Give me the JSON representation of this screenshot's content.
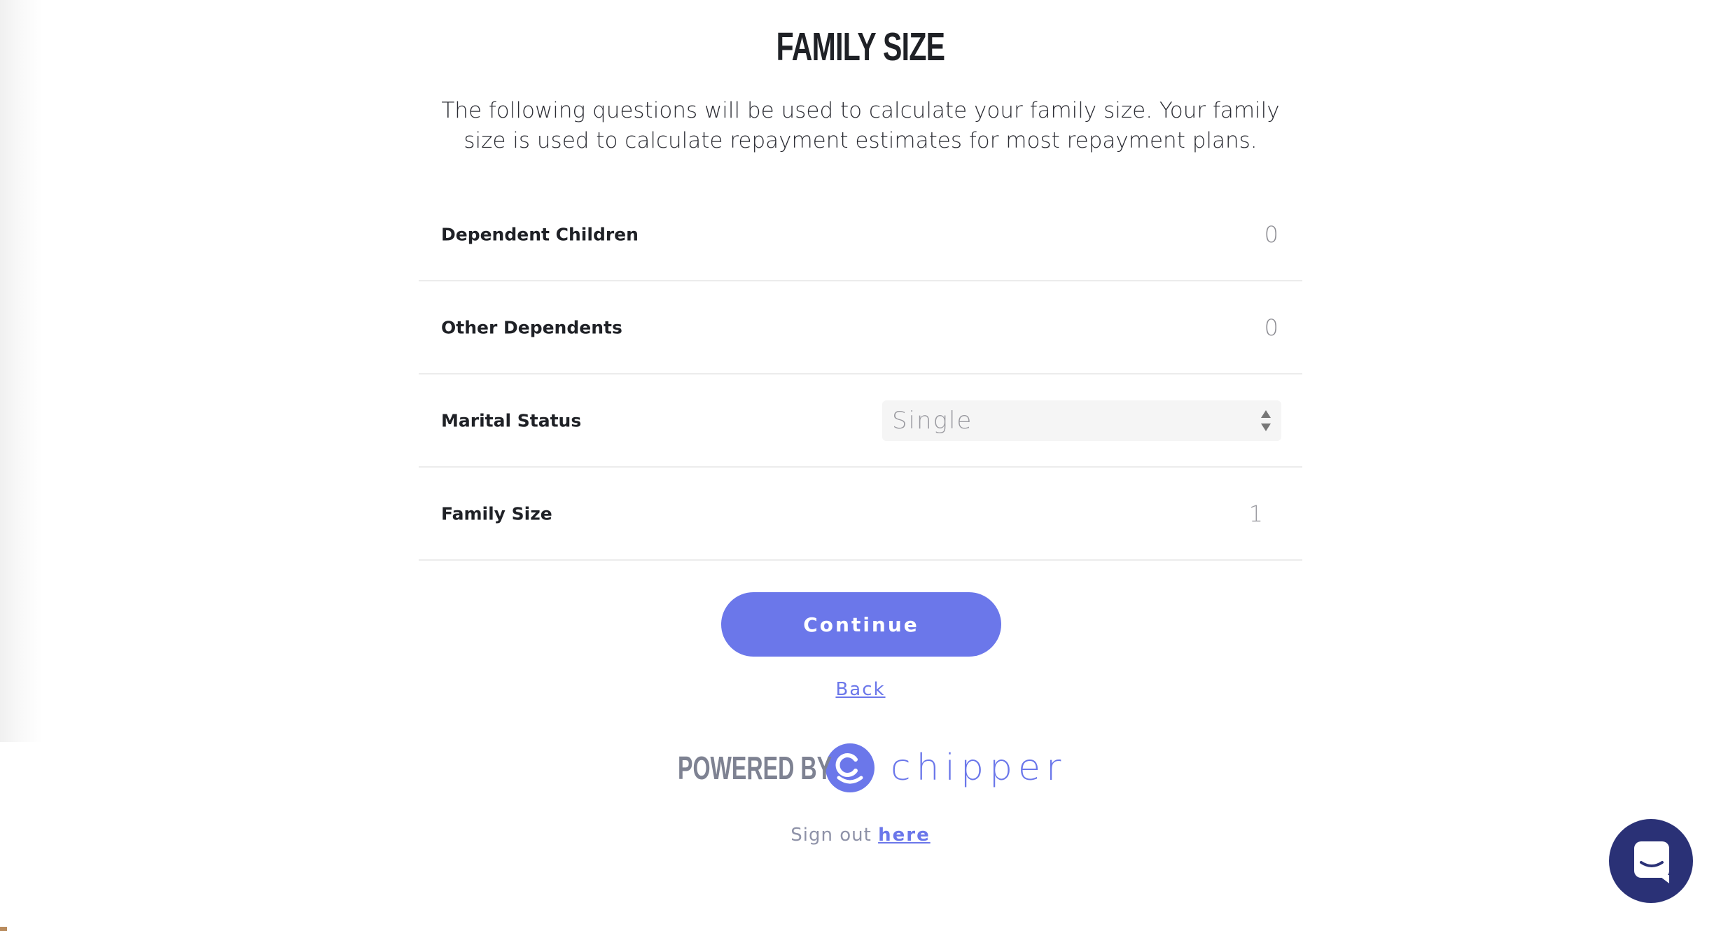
{
  "header": {
    "title": "FAMILY SIZE",
    "subtitle": "The following questions will be used to calculate your family size. Your family size is used to calculate repayment estimates for most repayment plans."
  },
  "form": {
    "dependent_children": {
      "label": "Dependent Children",
      "value": "0"
    },
    "other_dependents": {
      "label": "Other Dependents",
      "value": "0"
    },
    "marital_status": {
      "label": "Marital Status",
      "selected": "Single"
    },
    "family_size": {
      "label": "Family Size",
      "value": "1"
    }
  },
  "actions": {
    "continue_label": "Continue",
    "back_label": "Back"
  },
  "footer": {
    "powered_by": "POWERED BY",
    "brand": "chipper",
    "signout_prefix": "Sign out",
    "signout_link": "here"
  },
  "colors": {
    "accent": "#6b77ea",
    "chat_button": "#2a3176",
    "text_primary": "#1f2126",
    "muted": "#8e92a8"
  },
  "icons": {
    "brand_logo": "chipper-logo-icon",
    "select_arrows": "select-arrows-icon",
    "chat": "chat-icon"
  }
}
